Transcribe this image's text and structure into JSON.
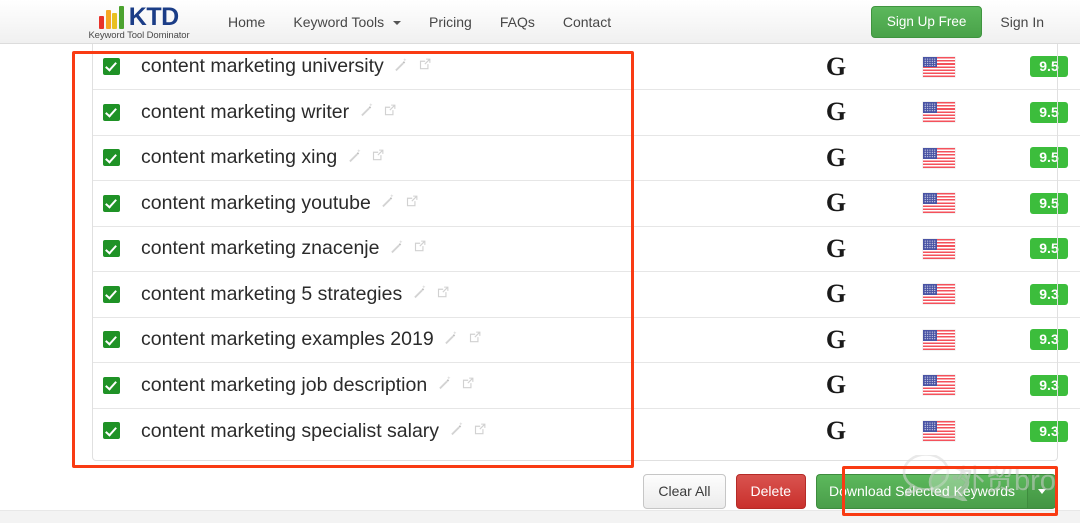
{
  "header": {
    "brand": {
      "name": "KTD",
      "tagline": "Keyword Tool Dominator",
      "bar_colors": [
        "#e8322a",
        "#f5a623",
        "#e8c020",
        "#4ba32f"
      ]
    },
    "nav": [
      {
        "label": "Home",
        "has_caret": false
      },
      {
        "label": "Keyword Tools",
        "has_caret": true
      },
      {
        "label": "Pricing",
        "has_caret": false
      },
      {
        "label": "FAQs",
        "has_caret": false
      },
      {
        "label": "Contact",
        "has_caret": false
      }
    ],
    "signup_label": "Sign Up Free",
    "signin_label": "Sign In",
    "signup_color": "#4fa94f"
  },
  "table": {
    "rows": [
      {
        "checked": true,
        "keyword": "content marketing university",
        "engine": "G",
        "country": "US",
        "score": "9.5"
      },
      {
        "checked": true,
        "keyword": "content marketing writer",
        "engine": "G",
        "country": "US",
        "score": "9.5"
      },
      {
        "checked": true,
        "keyword": "content marketing xing",
        "engine": "G",
        "country": "US",
        "score": "9.5"
      },
      {
        "checked": true,
        "keyword": "content marketing youtube",
        "engine": "G",
        "country": "US",
        "score": "9.5"
      },
      {
        "checked": true,
        "keyword": "content marketing znacenje",
        "engine": "G",
        "country": "US",
        "score": "9.5"
      },
      {
        "checked": true,
        "keyword": "content marketing 5 strategies",
        "engine": "G",
        "country": "US",
        "score": "9.3"
      },
      {
        "checked": true,
        "keyword": "content marketing examples 2019",
        "engine": "G",
        "country": "US",
        "score": "9.3"
      },
      {
        "checked": true,
        "keyword": "content marketing job description",
        "engine": "G",
        "country": "US",
        "score": "9.3"
      },
      {
        "checked": true,
        "keyword": "content marketing specialist salary",
        "engine": "G",
        "country": "US",
        "score": "9.3"
      }
    ],
    "checkbox_color": "#1f9226",
    "score_badge_color": "#3cbd3c"
  },
  "actions": {
    "clear_all_label": "Clear All",
    "delete_label": "Delete",
    "download_label": "Download Selected Keywords",
    "delete_color": "#c9302c",
    "download_color": "#4a9e4a"
  },
  "annotations": {
    "color": "#f93b13",
    "boxes": [
      "keyword-list",
      "download-button"
    ]
  },
  "watermark": {
    "text": "外贸bro",
    "logo": "wechat-logo"
  }
}
